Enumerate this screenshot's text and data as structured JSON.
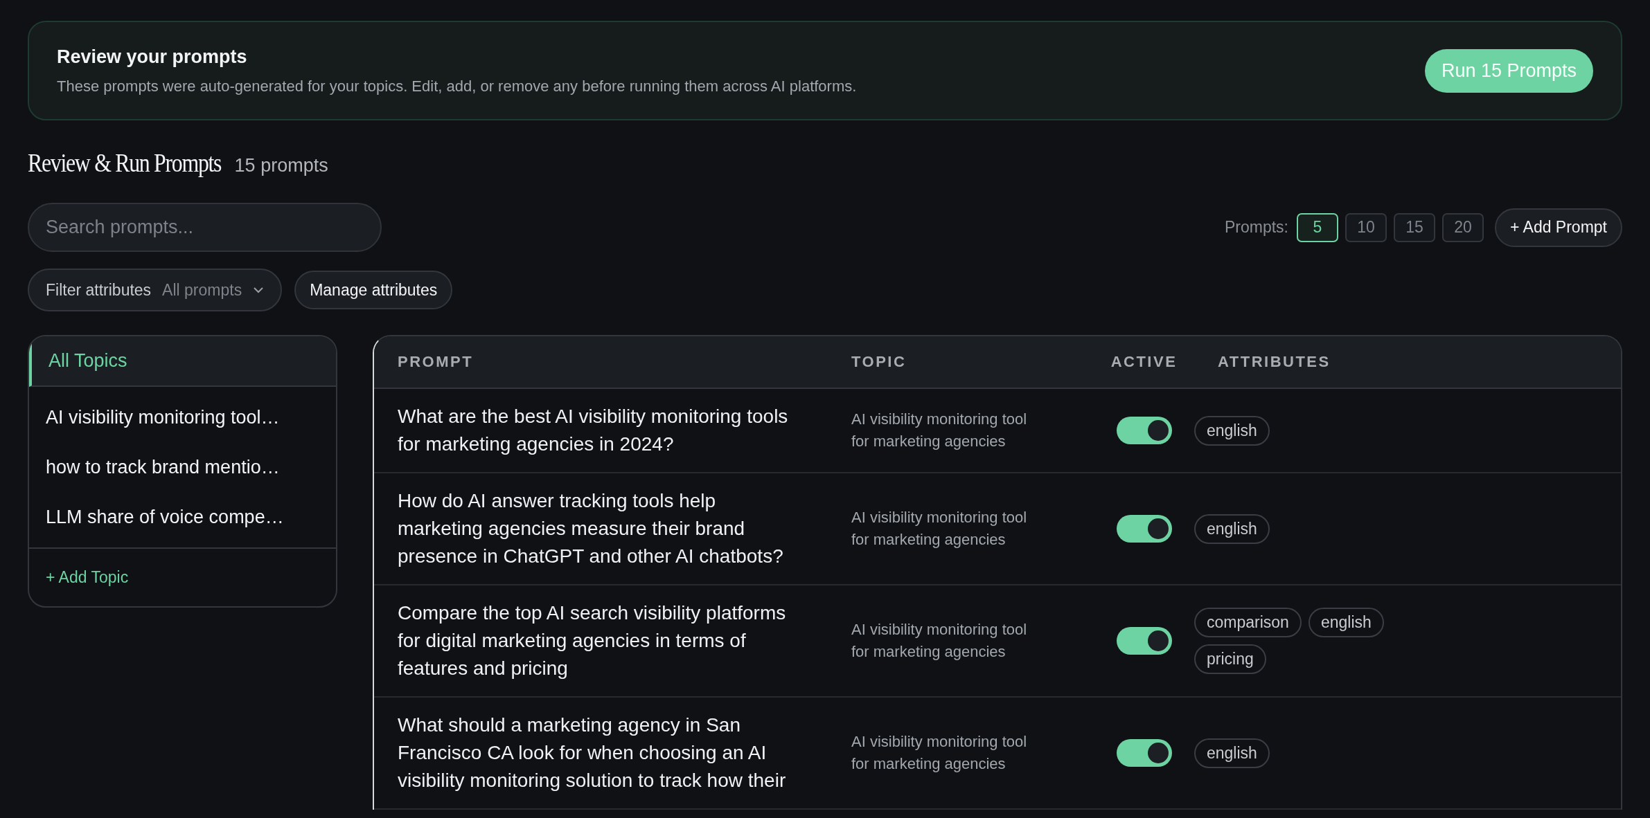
{
  "banner": {
    "title": "Review your prompts",
    "description": "These prompts were auto-generated for your topics. Edit, add, or remove any before running them across AI platforms.",
    "button": "Run 15 Prompts"
  },
  "header": {
    "title": "Review & Run Prompts",
    "count": "15 prompts"
  },
  "search": {
    "placeholder": "Search prompts..."
  },
  "page_size": {
    "label": "Prompts:",
    "options": [
      {
        "label": "5",
        "selected": true
      },
      {
        "label": "10",
        "selected": false
      },
      {
        "label": "15",
        "selected": false
      },
      {
        "label": "20",
        "selected": false
      }
    ]
  },
  "add_prompt_button": "+ Add Prompt",
  "filter": {
    "label": "Filter attributes",
    "value": "All prompts"
  },
  "manage_attributes_button": "Manage attributes",
  "sidebar": {
    "items": [
      {
        "label": "All Topics",
        "selected": true
      },
      {
        "label": "AI visibility monitoring tool…",
        "selected": false
      },
      {
        "label": "how to track brand mentio…",
        "selected": false
      },
      {
        "label": "LLM share of voice compe…",
        "selected": false
      }
    ],
    "add_button": "+ Add Topic"
  },
  "table": {
    "columns": [
      "PROMPT",
      "TOPIC",
      "ACTIVE",
      "ATTRIBUTES"
    ],
    "rows": [
      {
        "prompt": "What are the best AI visibility monitoring tools for marketing agencies in 2024?",
        "topic": "AI visibility monitoring tool for marketing agencies",
        "active": true,
        "attributes": [
          "english"
        ]
      },
      {
        "prompt": "How do AI answer tracking tools help marketing agencies measure their brand presence in ChatGPT and other AI chatbots?",
        "topic": "AI visibility monitoring tool for marketing agencies",
        "active": true,
        "attributes": [
          "english"
        ]
      },
      {
        "prompt": "Compare the top AI search visibility platforms for digital marketing agencies in terms of features and pricing",
        "topic": "AI visibility monitoring tool for marketing agencies",
        "active": true,
        "attributes": [
          "comparison",
          "english",
          "pricing"
        ]
      },
      {
        "prompt": "What should a marketing agency in San Francisco CA look for when choosing an AI visibility monitoring solution to track how their",
        "topic": "AI visibility monitoring tool for marketing agencies",
        "active": true,
        "attributes": [
          "english"
        ]
      }
    ]
  }
}
